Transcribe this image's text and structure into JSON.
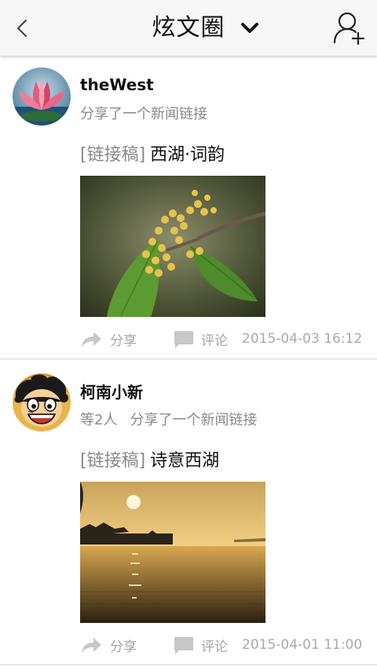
{
  "header": {
    "title": "炫文圈",
    "back_icon": "chevron-left-icon",
    "dropdown_icon": "chevron-down-icon",
    "add_user_icon": "add-user-icon"
  },
  "feed": [
    {
      "username": "theWest",
      "activity": "分享了一个新闻链接",
      "tag": "[链接稿]",
      "headline": "西湖·词韵",
      "image": "osmanthus-flower-photo",
      "share_label": "分享",
      "comment_label": "评论",
      "timestamp": "2015-04-03 16:12"
    },
    {
      "username": "柯南小新",
      "participants": "等2人",
      "activity": "分享了一个新闻链接",
      "tag": "[链接稿]",
      "headline": "诗意西湖",
      "image": "west-lake-sunset-photo",
      "share_label": "分享",
      "comment_label": "评论",
      "timestamp": "2015-04-01 11:00"
    }
  ]
}
